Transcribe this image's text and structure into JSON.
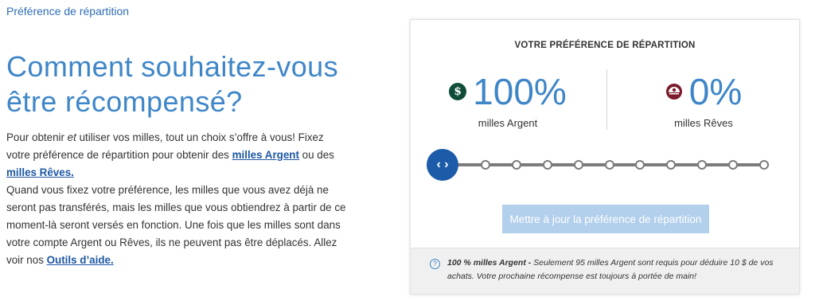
{
  "breadcrumb": "Préférence de répartition",
  "heading": "Comment souhaitez-vous être récompensé?",
  "intro": {
    "p1_a": "Pour obtenir ",
    "p1_em": "et",
    "p1_b": " utiliser vos milles, tout un choix s’offre à vous! Fixez votre préférence de répartition pour obtenir des ",
    "link_argent": "milles Argent",
    "p1_c": " ou des ",
    "link_reves": "milles Rêves.",
    "p2_a": "Quand vous fixez votre préférence, les milles que vous avez déjà ne seront pas transférés, mais les milles que vous obtiendrez à partir de ce moment-là seront versés en fonction. Une fois que les milles sont dans votre compte Argent ou Rêves, ils ne peuvent pas être déplacés. Allez voir nos ",
    "link_tools": "Outils d’aide."
  },
  "card": {
    "title": "VOTRE PRÉFÉRENCE DE RÉPARTITION",
    "argent": {
      "icon": "dollar-coin-icon",
      "percent": "100%",
      "label": "milles Argent"
    },
    "reves": {
      "icon": "dream-tree-icon",
      "percent": "0%",
      "label": "milles Rêves"
    },
    "slider": {
      "value_percent_argent": 100,
      "steps": 10,
      "handle_glyph": "‹ ›"
    },
    "button": "Mettre à jour la préférence de répartition",
    "footer_bold": "100 % milles Argent - ",
    "footer_text": "Seulement 95 milles Argent sont requis pour déduire 10 $ de vos achats. Votre prochaine récompense est toujours à portée de main!",
    "help_glyph": "?"
  },
  "colors": {
    "accent": "#3f86c8",
    "link": "#1d57a4",
    "handle": "#1c5ba8",
    "button_disabled": "#b2cfec",
    "argent_icon": "#0f4d3a",
    "reves_icon": "#7a1a2a"
  }
}
